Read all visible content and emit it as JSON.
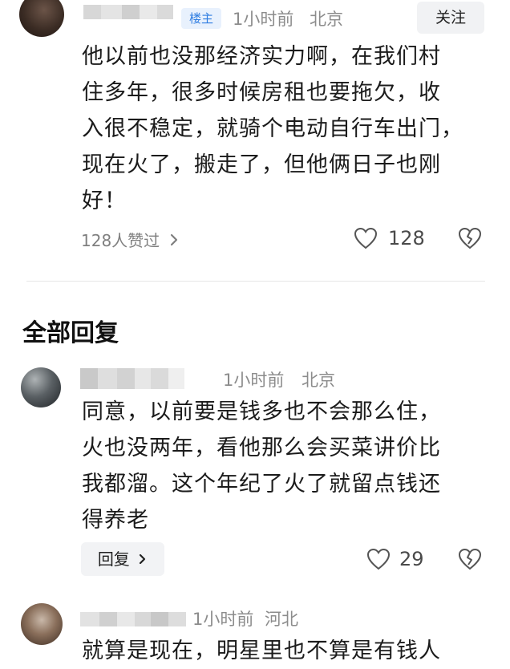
{
  "op_comment": {
    "author_tag": "楼主",
    "time": "1小时前",
    "location": "北京",
    "follow_label": "关注",
    "lines": [
      "他以前也没那经济实力啊，在我们村",
      "住多年，很多时候房租也要拖欠，收",
      "入很不稳定，就骑个电动自行车出门，",
      "现在火了，搬走了，但他俩日子也刚",
      "好！"
    ],
    "likes_text": "128人赞过",
    "like_count": "128"
  },
  "section_title": "全部回复",
  "replies": [
    {
      "time": "1小时前",
      "location": "北京",
      "lines": [
        "同意，以前要是钱多也不会那么住，",
        "火也没两年，看他那么会买菜讲价比",
        "我都溜。这个年纪了火了就留点钱还",
        "得养老"
      ],
      "reply_label": "回复",
      "like_count": "29"
    },
    {
      "time": "1小时前",
      "location": "河北",
      "partial_line": "就算是现在，明星里也不算是有钱人"
    }
  ],
  "icons": {
    "like": "heart-outline-icon",
    "dislike": "broken-heart-icon",
    "more": "chevron-right-icon"
  },
  "colors": {
    "tag_bg": "#e8f1fd",
    "tag_text": "#2f7de1",
    "meta_text": "#8c8c8c"
  }
}
